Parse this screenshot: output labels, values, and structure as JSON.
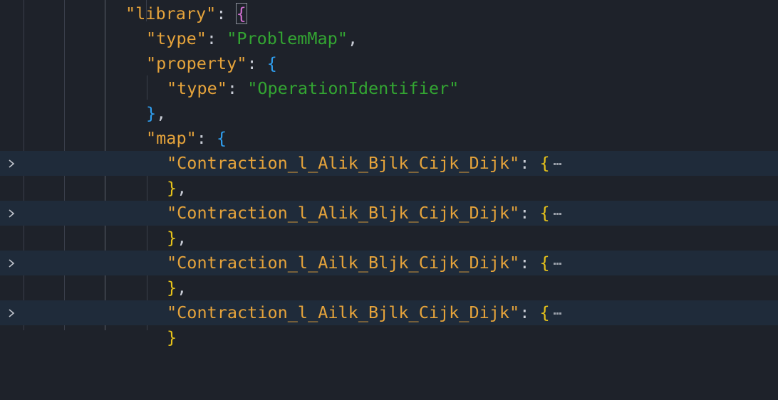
{
  "editor": {
    "lines": [
      {
        "key": "\"library\"",
        "colon": ": ",
        "open": "{"
      },
      {
        "key": "\"type\"",
        "colon": ": ",
        "value": "\"ProblemMap\"",
        "trail": ","
      },
      {
        "key": "\"property\"",
        "colon": ": ",
        "open": "{"
      },
      {
        "key": "\"type\"",
        "colon": ": ",
        "value": "\"OperationIdentifier\""
      },
      {
        "close": "}",
        "trail": ","
      },
      {
        "key": "\"map\"",
        "colon": ": ",
        "open": "{"
      },
      {
        "key": "\"Contraction_l_Alik_Bjlk_Cijk_Dijk\"",
        "colon": ": ",
        "open": "{"
      },
      {
        "close": "}",
        "trail": ","
      },
      {
        "key": "\"Contraction_l_Alik_Bljk_Cijk_Dijk\"",
        "colon": ": ",
        "open": "{"
      },
      {
        "close": "}",
        "trail": ","
      },
      {
        "key": "\"Contraction_l_Ailk_Bljk_Cijk_Dijk\"",
        "colon": ": ",
        "open": "{"
      },
      {
        "close": "}",
        "trail": ","
      },
      {
        "key": "\"Contraction_l_Ailk_Bjlk_Cijk_Dijk\"",
        "colon": ": ",
        "open": "{"
      },
      {
        "close": "}"
      }
    ],
    "fold_icon": "chevron-right-icon",
    "ellipsis_icon": "folded-ellipsis-icon"
  },
  "colors": {
    "background": "#1e222a",
    "folded_line_highlight": "#1f2b3a",
    "key": "#e5a33b",
    "string": "#33a532",
    "bracket_level1": "#e6c21a",
    "bracket_level2": "#d16fd1",
    "bracket_level3": "#2f9ff0"
  }
}
